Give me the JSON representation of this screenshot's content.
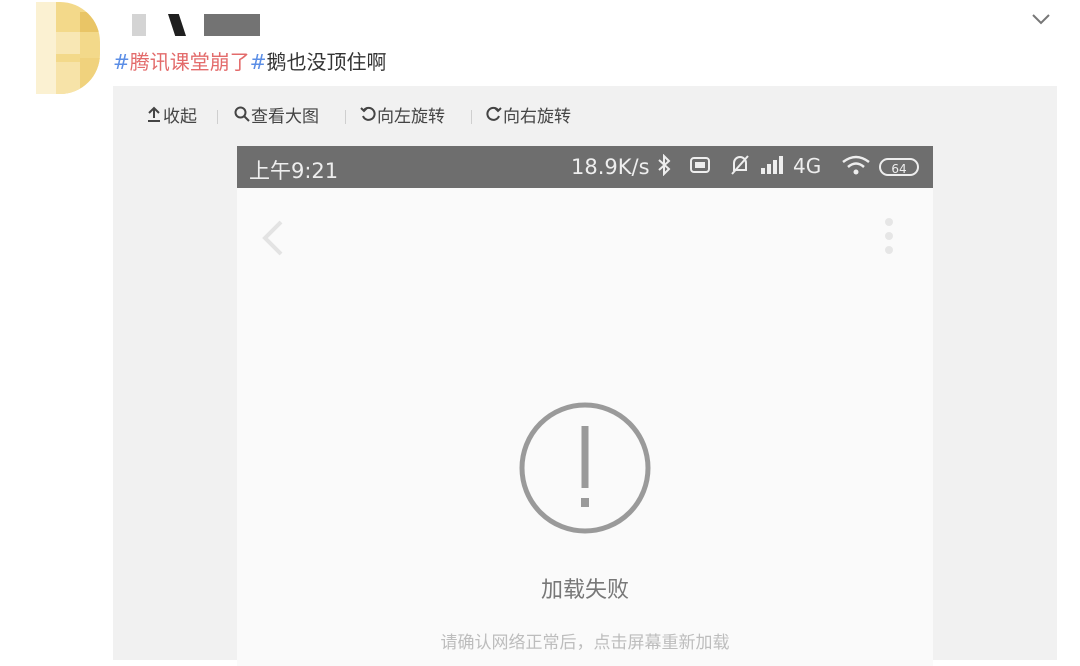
{
  "post": {
    "hashtag1": "#腾讯课堂崩了#",
    "text": "鹅也没顶住啊"
  },
  "toolbar": {
    "collapse": "收起",
    "view_large": "查看大图",
    "rotate_left": "向左旋转",
    "rotate_right": "向右旋转"
  },
  "phone": {
    "status": {
      "time": "上午9:21",
      "speed": "18.9K/s",
      "network": "4G",
      "battery": "64"
    },
    "error": {
      "title": "加载失败",
      "hint": "请确认网络正常后，点击屏幕重新加载"
    }
  },
  "icons": [
    "chevron-down-icon",
    "upload-icon",
    "search-icon",
    "rotate-left-icon",
    "rotate-right-icon",
    "back-icon",
    "more-icon",
    "bluetooth-icon",
    "nfc-icon",
    "mute-icon",
    "signal-icon",
    "wifi-icon",
    "battery-icon",
    "warning-circle-icon"
  ],
  "colors": {
    "hashtag": "#5b8ee6",
    "topic": "#e36b6b",
    "statusbar": "#6e6e6e",
    "panel": "#f1f1f1"
  }
}
